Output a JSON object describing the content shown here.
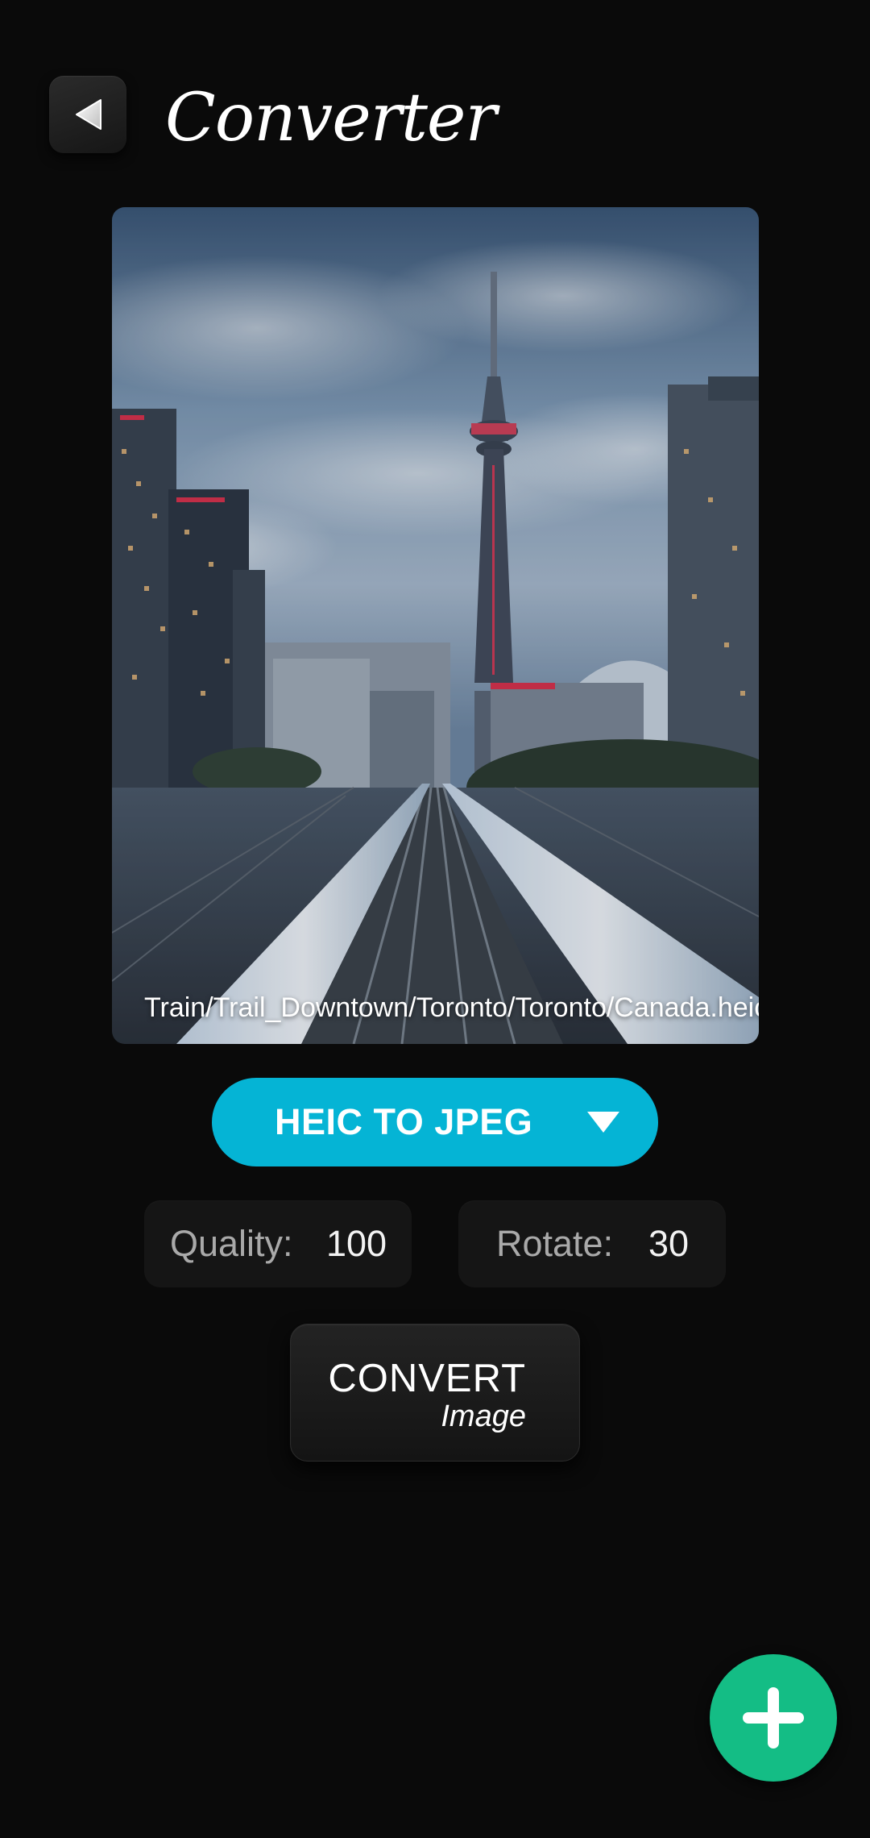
{
  "header": {
    "back_icon": "back-arrow-icon",
    "title": "Converter"
  },
  "preview": {
    "file_path": "Train/Trail_Downtown/Toronto/Toronto/Canada.heic"
  },
  "format_select": {
    "value": "HEIC TO JPEG",
    "icon": "caret-down-icon",
    "color": "#05b4d5"
  },
  "options": {
    "quality": {
      "label": "Quality:",
      "value": "100"
    },
    "rotate": {
      "label": "Rotate:",
      "value": "30"
    }
  },
  "convert_button": {
    "label": "CONVERT",
    "sublabel": "Image"
  },
  "fab": {
    "icon": "plus-icon",
    "color": "#14bd85"
  }
}
